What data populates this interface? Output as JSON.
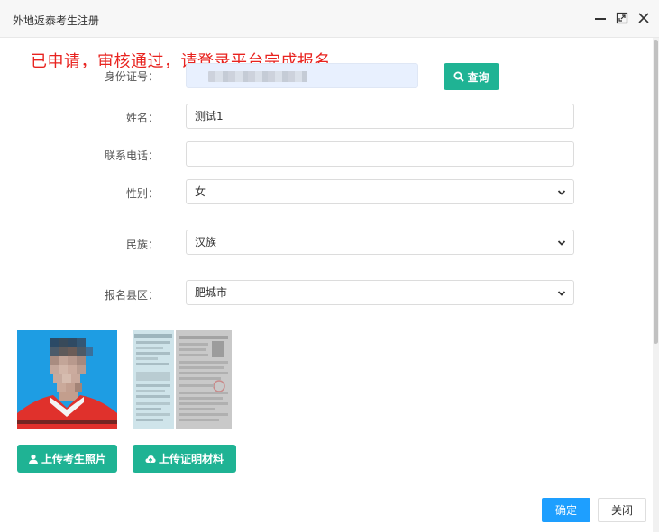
{
  "window": {
    "title": "外地返泰考生注册",
    "minimize_icon": "minimize-icon",
    "maximize_icon": "maximize-icon",
    "close_icon": "close-icon"
  },
  "notice": "已申请，审核通过，请登录平台完成报名",
  "form": {
    "id_number": {
      "label": "身份证号：",
      "value": ""
    },
    "query_button": {
      "label": "查询",
      "icon": "search-icon"
    },
    "name": {
      "label": "姓名：",
      "value": "测试1"
    },
    "phone": {
      "label": "联系电话：",
      "value": ""
    },
    "gender": {
      "label": "性别：",
      "value": "女"
    },
    "ethnicity": {
      "label": "民族：",
      "value": "汉族"
    },
    "county": {
      "label": "报名县区：",
      "value": "肥城市"
    }
  },
  "uploads": {
    "photo_button": {
      "label": "上传考生照片",
      "icon": "user-icon"
    },
    "materials_button": {
      "label": "上传证明材料",
      "icon": "cloud-upload-icon"
    }
  },
  "footer": {
    "ok": "确定",
    "close": "关闭"
  },
  "colors": {
    "accent_green": "#1fb394",
    "primary_blue": "#1e9fff",
    "notice_red": "#e8231f"
  }
}
